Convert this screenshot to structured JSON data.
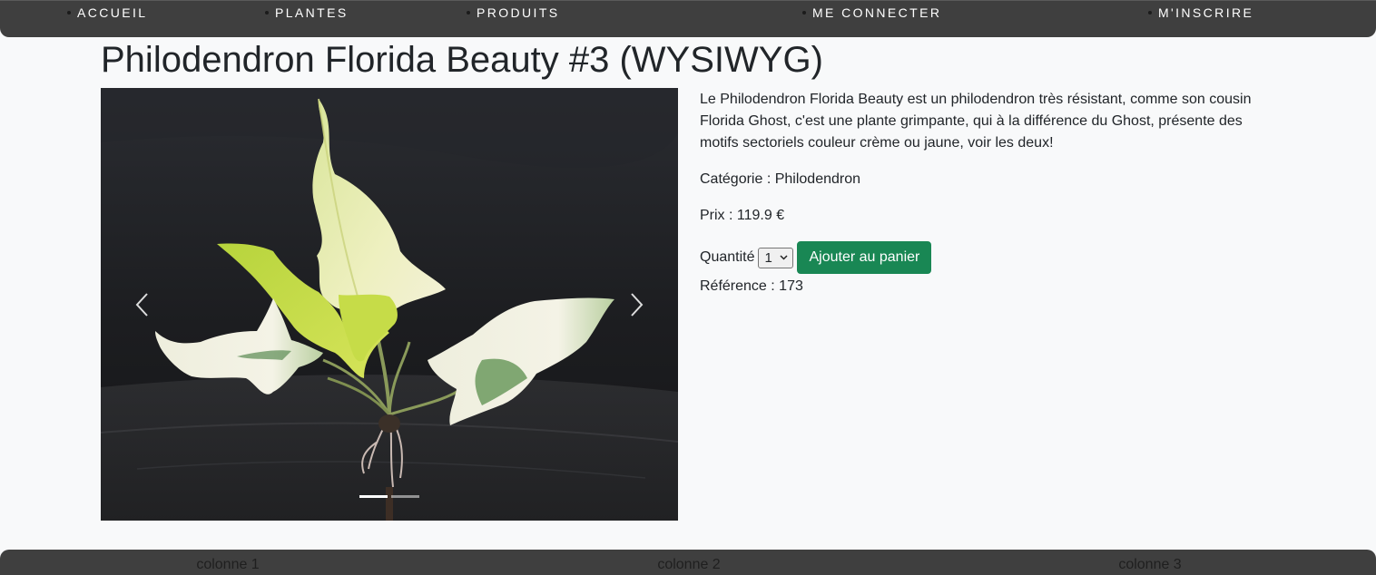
{
  "nav": {
    "items": [
      {
        "label": "ACCUEIL"
      },
      {
        "label": "PLANTES"
      },
      {
        "label": "PRODUITS"
      },
      {
        "label": "ME CONNECTER"
      },
      {
        "label": "M'INSCRIRE"
      }
    ]
  },
  "product": {
    "title": "Philodendron Florida Beauty #3 (WYSIWYG)",
    "description": "Le Philodendron Florida Beauty est un philodendron très résistant, comme son cousin Florida Ghost, c'est une plante grimpante, qui à la différence du Ghost, présente des motifs sectoriels couleur crème ou jaune, voir les deux!",
    "category_label": "Catégorie :",
    "category_value": "Philodendron",
    "price_label": "Prix :",
    "price_value": "119.9 €",
    "quantity_label": "Quantité",
    "quantity_value": "1",
    "add_to_cart_label": "Ajouter au panier",
    "reference_label": "Référence :",
    "reference_value": "173"
  },
  "carousel": {
    "slide_count": 2,
    "active_index": 0,
    "prev_icon": "chevron-left-icon",
    "next_icon": "chevron-right-icon"
  },
  "footer": {
    "columns": [
      {
        "label": "colonne 1"
      },
      {
        "label": "colonne 2"
      },
      {
        "label": "colonne 3"
      }
    ]
  },
  "colors": {
    "navbar_bg": "#3f3f3f",
    "page_bg": "#f8f9fa",
    "button_green": "#198754",
    "text": "#212529"
  }
}
